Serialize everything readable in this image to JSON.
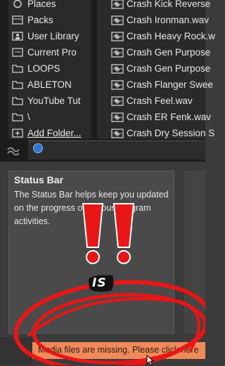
{
  "sidebar": {
    "items": [
      {
        "label": "Places",
        "icon": "places-icon"
      },
      {
        "label": "Packs",
        "icon": "packs-icon"
      },
      {
        "label": "User Library",
        "icon": "user-library-icon"
      },
      {
        "label": "Current Pro",
        "icon": "current-project-icon"
      },
      {
        "label": "LOOPS",
        "icon": "folder-icon"
      },
      {
        "label": "ABLETON",
        "icon": "folder-icon"
      },
      {
        "label": "YouTube Tut",
        "icon": "folder-icon"
      },
      {
        "label": "\\",
        "icon": "folder-icon"
      },
      {
        "label": "Add Folder...",
        "icon": "add-folder-icon"
      }
    ]
  },
  "files": {
    "items": [
      {
        "label": "Crash Kick Reverse"
      },
      {
        "label": "Crash Ironman.wav"
      },
      {
        "label": "Crash Heavy Rock.w"
      },
      {
        "label": "Crash Gen Purpose"
      },
      {
        "label": "Crash Gen Purpose"
      },
      {
        "label": "Crash Flanger Swee"
      },
      {
        "label": "Crash Feel.wav"
      },
      {
        "label": "Crash ER Fenk.wav"
      },
      {
        "label": "Crash Dry Session S"
      }
    ],
    "icon": "audio-file-icon"
  },
  "info": {
    "title": "Status Bar",
    "body": "The Status Bar helps keep you updated on the progress of various program activities."
  },
  "status_bar": {
    "message": "Media files are missing. Please click here"
  },
  "overlay": {
    "word": "IS",
    "annotation_color": "#e81616"
  },
  "colors": {
    "status_bar_bg": "#f08a5a",
    "accent_blue": "#2f79d0"
  }
}
